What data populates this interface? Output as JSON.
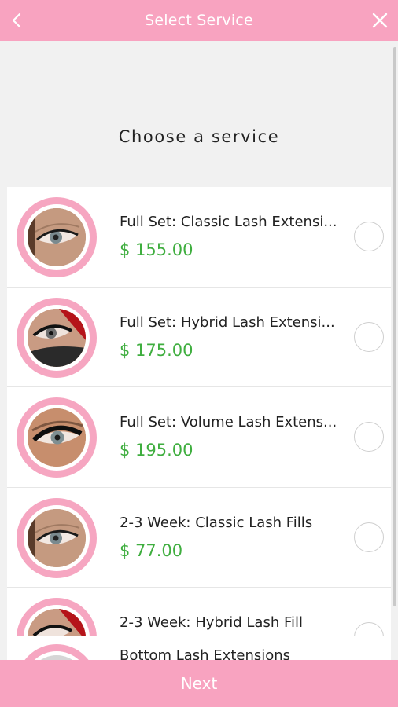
{
  "header": {
    "title": "Select Service",
    "back_icon": "chevron-left-icon",
    "close_icon": "close-icon"
  },
  "page": {
    "heading": "Choose a service"
  },
  "services": [
    {
      "name": "Full Set: Classic Lash Extensi...",
      "price": "$ 155.00",
      "image": "eye-classic"
    },
    {
      "name": "Full Set: Hybrid Lash Extensi...",
      "price": "$ 175.00",
      "image": "eye-hybrid"
    },
    {
      "name": "Full Set: Volume Lash Extens...",
      "price": "$ 195.00",
      "image": "eye-volume"
    },
    {
      "name": "2-3 Week: Classic Lash Fills",
      "price": "$ 77.00",
      "image": "eye-classic"
    },
    {
      "name": "2-3 Week: Hybrid Lash Fill",
      "price": "",
      "image": "eye-hybrid"
    }
  ],
  "peek_item": {
    "name": "Bottom Lash Extensions"
  },
  "footer": {
    "next_label": "Next"
  },
  "colors": {
    "primary_pink": "#f8a3c0",
    "price_green": "#3fae3f"
  }
}
